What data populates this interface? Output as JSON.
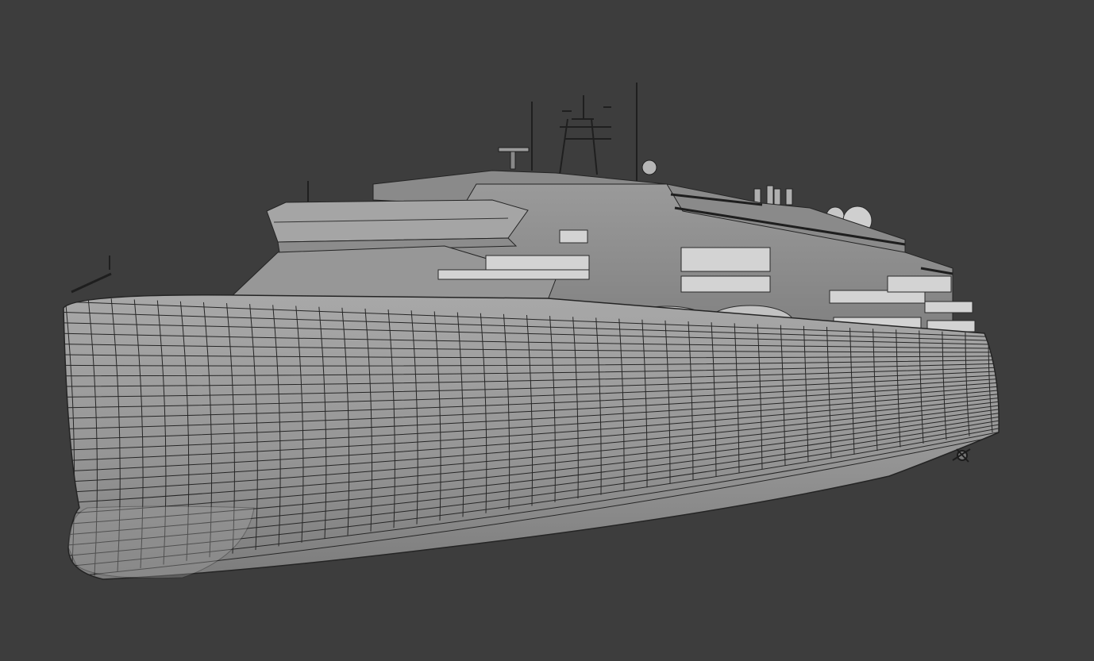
{
  "viewport": {
    "background_color": "#3d3d3d",
    "shading_mode": "solid-wireframe",
    "object": "ship-model"
  },
  "colors": {
    "hull_light": "#a3a3a3",
    "hull_mid": "#8f8f8f",
    "hull_dark": "#7a7a7a",
    "wire": "#2b2b2b",
    "window": "#d6d6d6"
  }
}
